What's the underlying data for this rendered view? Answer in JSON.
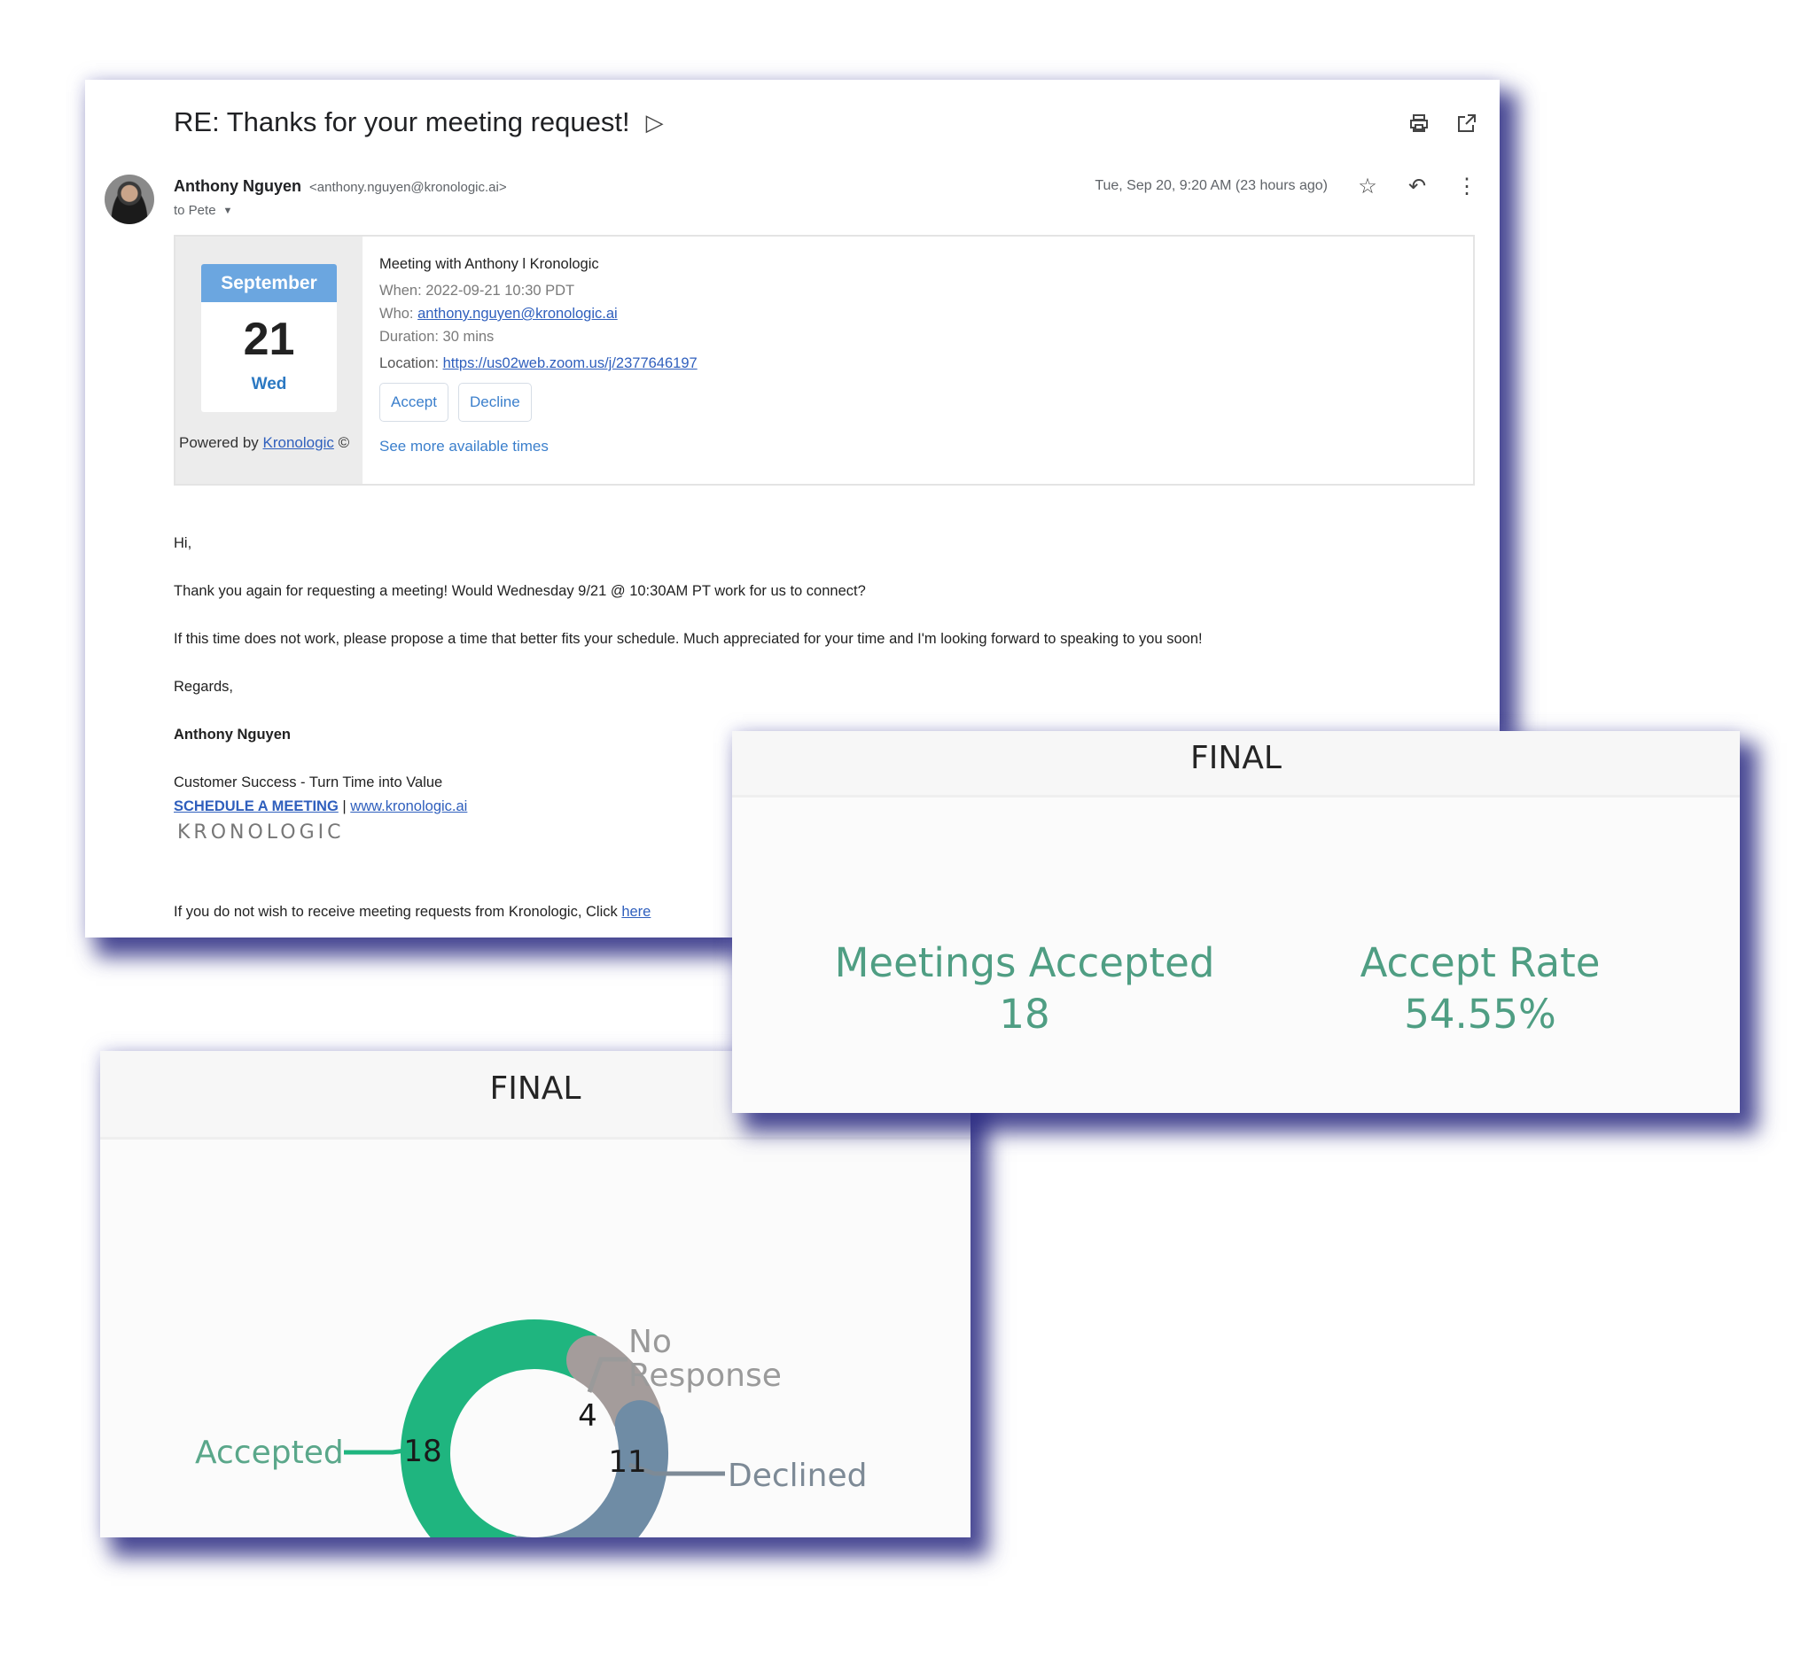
{
  "email": {
    "subject": "RE: Thanks for your meeting request!",
    "subject_icon": "label-arrow-icon",
    "toolbar_icons": [
      "print-icon",
      "open-in-new-window-icon"
    ],
    "sender_name": "Anthony Nguyen",
    "sender_email": "<anthony.nguyen@kronologic.ai>",
    "recipient_line": "to Pete",
    "date": "Tue, Sep 20, 9:20 AM (23 hours ago)",
    "action_icons": [
      "star-icon",
      "reply-icon",
      "more-vert-icon"
    ],
    "invite": {
      "month": "September",
      "day": "21",
      "weekday": "Wed",
      "powered_by_prefix": "Powered by",
      "powered_by_link": "Kronologic",
      "powered_by_suffix": "©",
      "title": "Meeting with Anthony l Kronologic",
      "when": "When: 2022-09-21 10:30 PDT",
      "who_label": "Who:",
      "who_email": "anthony.nguyen@kronologic.ai",
      "duration": "Duration: 30 mins",
      "location_label": "Location:",
      "location_url": "https://us02web.zoom.us/j/2377646197",
      "accept_label": "Accept",
      "decline_label": "Decline",
      "more_times_label": "See more available times"
    },
    "body": {
      "greeting": "Hi,",
      "line1": "Thank you again for requesting a meeting! Would Wednesday 9/21 @ 10:30AM PT work for us to connect?",
      "line2": "If this time does not work, please propose a time that better fits your schedule. Much appreciated for your time and I'm looking forward to speaking to you soon!",
      "closing": "Regards,",
      "signature_name": "Anthony Nguyen",
      "signature_title": "Customer Success - Turn Time into Value",
      "schedule_link": "SCHEDULE A MEETING",
      "separator": "|",
      "website_link": "www.kronologic.ai",
      "logo_text": "KRONOLOGIC",
      "unsubscribe_text": "If you do not wish to receive meeting requests from Kronologic, Click",
      "unsubscribe_link": "here"
    }
  },
  "metrics_panel": {
    "title": "FINAL",
    "metrics": [
      {
        "label": "Meetings Accepted",
        "value": "18"
      },
      {
        "label": "Accept Rate",
        "value": "54.55%"
      }
    ],
    "accent_color": "#4f9e83"
  },
  "donut_panel": {
    "title": "FINAL"
  },
  "chart_data": {
    "type": "pie",
    "variant": "donut",
    "title": "FINAL",
    "categories": [
      "Accepted",
      "No Response",
      "Declined"
    ],
    "values": [
      18,
      4,
      11
    ],
    "colors": [
      "#1fb57f",
      "#a49c9b",
      "#6f8ca5"
    ],
    "label_colors": [
      "#5aa78a",
      "#9a9a9a",
      "#7d8a96"
    ],
    "data_labels": [
      "18",
      "4",
      "11"
    ],
    "legend": "none"
  }
}
